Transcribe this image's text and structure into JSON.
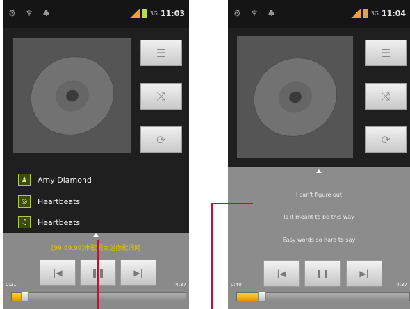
{
  "left_phone": {
    "status": {
      "time": "11:03",
      "network": "3G"
    },
    "side_buttons": [
      {
        "icon": "playlist-icon",
        "glyph": "☰"
      },
      {
        "icon": "shuffle-icon",
        "glyph": "⤨"
      },
      {
        "icon": "repeat-icon",
        "glyph": "⟳"
      }
    ],
    "track": {
      "artist": "Amy Diamond",
      "album": "Heartbeats",
      "title": "Heartbeats"
    },
    "lyric_line": "[99:99.99]本歌词由迷你歌词网",
    "elapsed": "0:21",
    "duration": "4:37",
    "progress_fraction": 0.076
  },
  "right_phone": {
    "status": {
      "time": "11:04",
      "network": "3G"
    },
    "side_buttons": [
      {
        "icon": "playlist-icon",
        "glyph": "☰"
      },
      {
        "icon": "shuffle-icon",
        "glyph": "⤨"
      },
      {
        "icon": "repeat-icon",
        "glyph": "⟳"
      }
    ],
    "lyrics": [
      "I can't figure out",
      "Is it meant to be this way",
      "Easy words so hard to say"
    ],
    "elapsed": "0:40",
    "duration": "4:37",
    "progress_fraction": 0.145
  },
  "controls": [
    {
      "icon": "previous-icon",
      "glyph": "|◀"
    },
    {
      "icon": "pause-icon",
      "glyph": "❚❚"
    },
    {
      "icon": "next-icon",
      "glyph": "▶|"
    }
  ],
  "colors": {
    "accent": "#e7c300",
    "pointer": "#c8102e"
  }
}
